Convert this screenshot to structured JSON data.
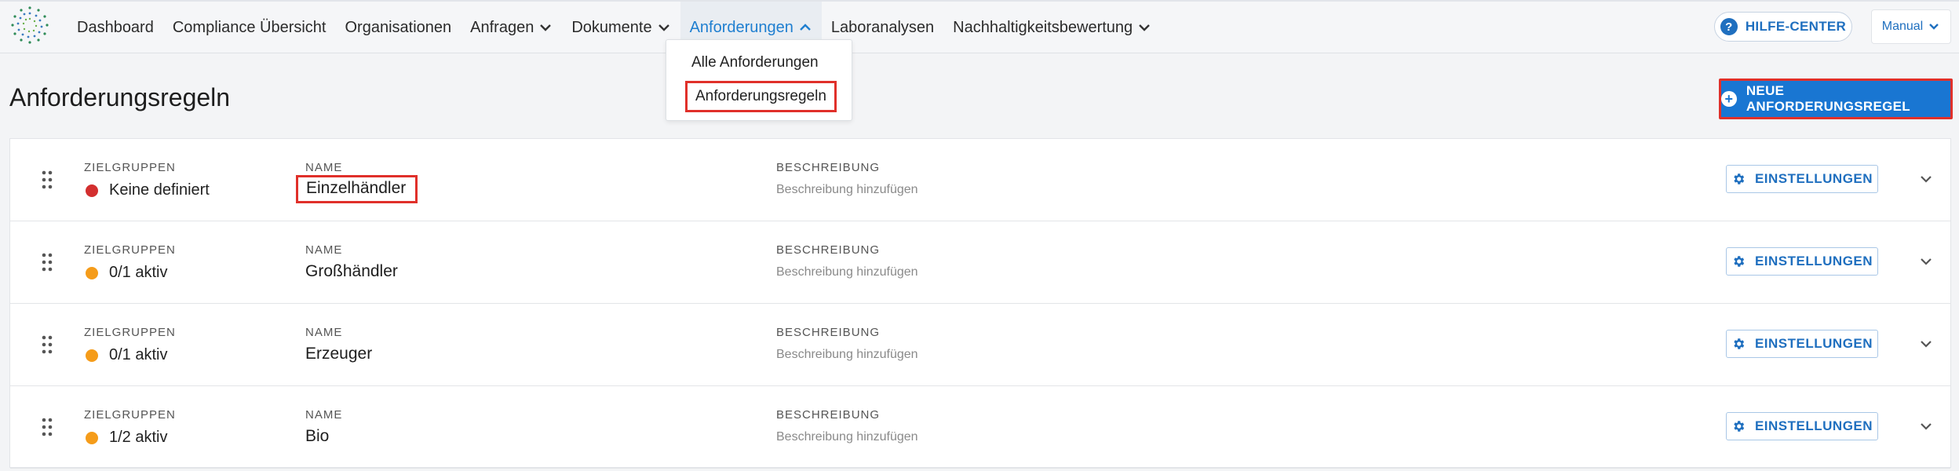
{
  "nav": {
    "items": [
      {
        "label": "Dashboard",
        "has_chevron": false
      },
      {
        "label": "Compliance Übersicht",
        "has_chevron": false
      },
      {
        "label": "Organisationen",
        "has_chevron": false
      },
      {
        "label": "Anfragen",
        "has_chevron": true
      },
      {
        "label": "Dokumente",
        "has_chevron": true
      },
      {
        "label": "Anforderungen",
        "has_chevron": true,
        "active": true
      },
      {
        "label": "Laboranalysen",
        "has_chevron": false
      },
      {
        "label": "Nachhaltigkeitsbewertung",
        "has_chevron": true
      }
    ],
    "help_label": "HILFE-CENTER",
    "help_icon": "?",
    "manual_label": "Manual"
  },
  "dropdown": {
    "items": [
      "Alle Anforderungen",
      "Anforderungsregeln"
    ]
  },
  "page": {
    "title": "Anforderungsregeln",
    "new_rule_label": "NEUE ANFORDERUNGSREGEL",
    "new_rule_icon": "+"
  },
  "columns": {
    "target": "ZIELGRUPPEN",
    "name": "NAME",
    "description": "BESCHREIBUNG"
  },
  "rules": [
    {
      "status": "Keine definiert",
      "status_color": "#d32f2f",
      "name": "Einzelhändler",
      "description": "Beschreibung hinzufügen"
    },
    {
      "status": "0/1 aktiv",
      "status_color": "#f59c1a",
      "name": "Großhändler",
      "description": "Beschreibung hinzufügen"
    },
    {
      "status": "0/1 aktiv",
      "status_color": "#f59c1a",
      "name": "Erzeuger",
      "description": "Beschreibung hinzufügen"
    },
    {
      "status": "1/2 aktiv",
      "status_color": "#f59c1a",
      "name": "Bio",
      "description": "Beschreibung hinzufügen"
    }
  ],
  "settings_label": "EINSTELLUNGEN",
  "colors": {
    "accent": "#1976d2",
    "highlight": "#e0302a"
  }
}
